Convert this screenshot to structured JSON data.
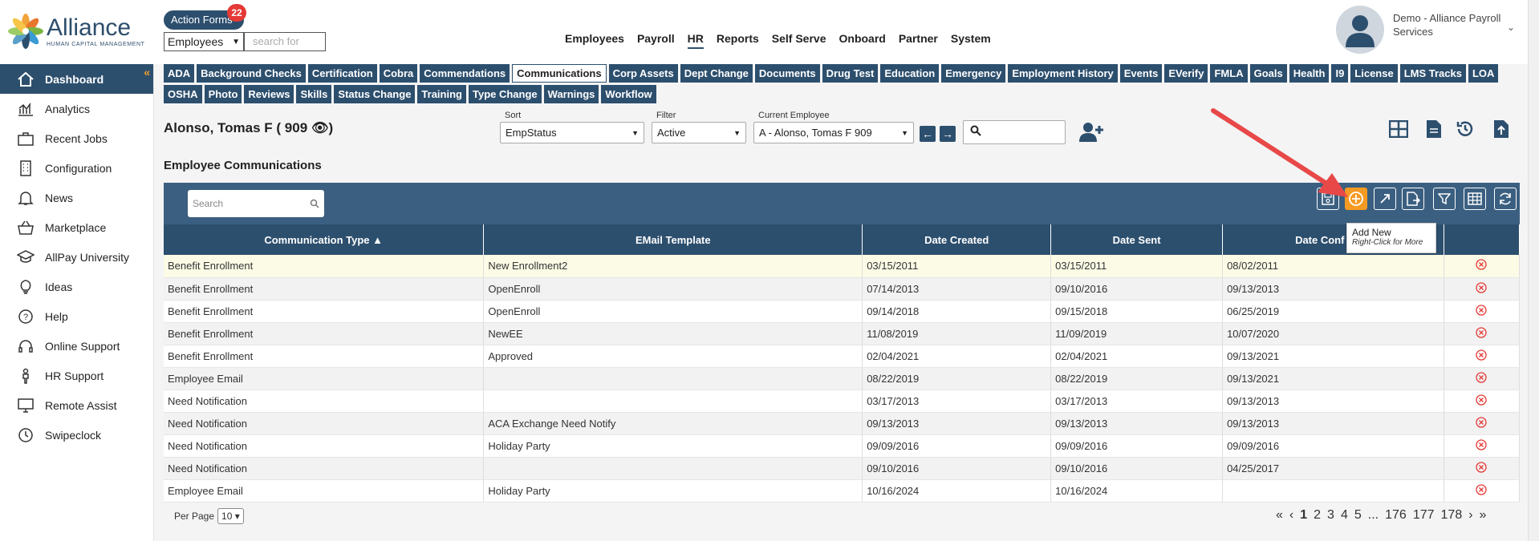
{
  "brand": {
    "name": "Alliance",
    "tagline": "HUMAN CAPITAL MANAGEMENT"
  },
  "header": {
    "action_forms_label": "Action Forms",
    "action_forms_count": "22",
    "employee_filter": "Employees",
    "search_placeholder": "search for",
    "nav": [
      "Employees",
      "Payroll",
      "HR",
      "Reports",
      "Self Serve",
      "Onboard",
      "Partner",
      "System"
    ],
    "nav_active": "HR",
    "user_name": "Demo - Alliance Payroll Services"
  },
  "sidebar": {
    "items": [
      {
        "label": "Dashboard",
        "icon": "home-icon"
      },
      {
        "label": "Analytics",
        "icon": "chart-icon"
      },
      {
        "label": "Recent Jobs",
        "icon": "briefcase-icon"
      },
      {
        "label": "Configuration",
        "icon": "building-icon"
      },
      {
        "label": "News",
        "icon": "bell-icon"
      },
      {
        "label": "Marketplace",
        "icon": "basket-icon"
      },
      {
        "label": "AllPay University",
        "icon": "graduation-cap-icon"
      },
      {
        "label": "Ideas",
        "icon": "lightbulb-icon"
      },
      {
        "label": "Help",
        "icon": "question-icon"
      },
      {
        "label": "Online Support",
        "icon": "headset-icon"
      },
      {
        "label": "HR Support",
        "icon": "person-icon"
      },
      {
        "label": "Remote Assist",
        "icon": "monitor-icon"
      },
      {
        "label": "Swipeclock",
        "icon": "clock-icon"
      }
    ]
  },
  "tabs": [
    "ADA",
    "Background Checks",
    "Certification",
    "Cobra",
    "Commendations",
    "Communications",
    "Corp Assets",
    "Dept Change",
    "Documents",
    "Drug Test",
    "Education",
    "Emergency",
    "Employment History",
    "Events",
    "EVerify",
    "FMLA",
    "Goals",
    "Health",
    "I9",
    "License",
    "LMS Tracks",
    "LOA",
    "OSHA",
    "Photo",
    "Reviews",
    "Skills",
    "Status Change",
    "Training",
    "Type Change",
    "Warnings",
    "Workflow"
  ],
  "active_tab": "Communications",
  "employee": {
    "name": "Alonso, Tomas F ( 909",
    "sort_label": "Sort",
    "sort_value": "EmpStatus",
    "filter_label": "Filter",
    "filter_value": "Active",
    "current_label": "Current Employee",
    "current_value": "A - Alonso, Tomas F 909"
  },
  "section_title": "Employee Communications",
  "grid": {
    "search_placeholder": "Search",
    "columns": [
      "Communication Type ▲",
      "EMail Template",
      "Date Created",
      "Date Sent",
      "Date Confirmed"
    ],
    "rows": [
      [
        "Benefit Enrollment",
        "New Enrollment2",
        "03/15/2011",
        "03/15/2011",
        "08/02/2011"
      ],
      [
        "Benefit Enrollment",
        "OpenEnroll",
        "07/14/2013",
        "09/10/2016",
        "09/13/2013"
      ],
      [
        "Benefit Enrollment",
        "OpenEnroll",
        "09/14/2018",
        "09/15/2018",
        "06/25/2019"
      ],
      [
        "Benefit Enrollment",
        "NewEE",
        "11/08/2019",
        "11/09/2019",
        "10/07/2020"
      ],
      [
        "Benefit Enrollment",
        "Approved",
        "02/04/2021",
        "02/04/2021",
        "09/13/2021"
      ],
      [
        "Employee Email",
        "",
        "08/22/2019",
        "08/22/2019",
        "09/13/2021"
      ],
      [
        "Need Notification",
        "",
        "03/17/2013",
        "03/17/2013",
        "09/13/2013"
      ],
      [
        "Need Notification",
        "ACA Exchange Need Notify",
        "09/13/2013",
        "09/13/2013",
        "09/13/2013"
      ],
      [
        "Need Notification",
        "Holiday Party",
        "09/09/2016",
        "09/09/2016",
        "09/09/2016"
      ],
      [
        "Need Notification",
        "",
        "09/10/2016",
        "09/10/2016",
        "04/25/2017"
      ],
      [
        "Employee Email",
        "Holiday Party",
        "10/16/2024",
        "10/16/2024",
        ""
      ]
    ],
    "tooltip_title": "Add New",
    "tooltip_sub": "Right-Click for More",
    "date_confirmed_visible": "Date Conf"
  },
  "pagination": {
    "per_page_label": "Per Page",
    "per_page_value": "10",
    "pages": [
      "1",
      "2",
      "3",
      "4",
      "5",
      "...",
      "176",
      "177",
      "178"
    ],
    "current": "1"
  },
  "colors": {
    "primary": "#2d4f6e",
    "accent": "#f59a23",
    "delete": "#e53935"
  }
}
